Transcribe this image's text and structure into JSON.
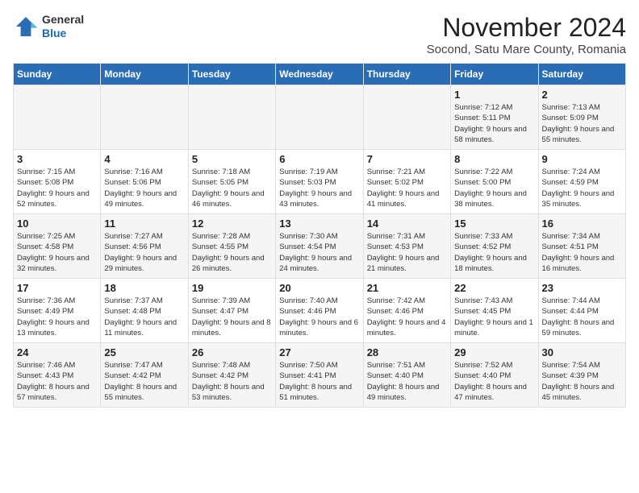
{
  "header": {
    "logo_line1": "General",
    "logo_line2": "Blue",
    "month_title": "November 2024",
    "subtitle": "Socond, Satu Mare County, Romania"
  },
  "days_of_week": [
    "Sunday",
    "Monday",
    "Tuesday",
    "Wednesday",
    "Thursday",
    "Friday",
    "Saturday"
  ],
  "weeks": [
    [
      {
        "day": "",
        "info": ""
      },
      {
        "day": "",
        "info": ""
      },
      {
        "day": "",
        "info": ""
      },
      {
        "day": "",
        "info": ""
      },
      {
        "day": "",
        "info": ""
      },
      {
        "day": "1",
        "info": "Sunrise: 7:12 AM\nSunset: 5:11 PM\nDaylight: 9 hours and 58 minutes."
      },
      {
        "day": "2",
        "info": "Sunrise: 7:13 AM\nSunset: 5:09 PM\nDaylight: 9 hours and 55 minutes."
      }
    ],
    [
      {
        "day": "3",
        "info": "Sunrise: 7:15 AM\nSunset: 5:08 PM\nDaylight: 9 hours and 52 minutes."
      },
      {
        "day": "4",
        "info": "Sunrise: 7:16 AM\nSunset: 5:06 PM\nDaylight: 9 hours and 49 minutes."
      },
      {
        "day": "5",
        "info": "Sunrise: 7:18 AM\nSunset: 5:05 PM\nDaylight: 9 hours and 46 minutes."
      },
      {
        "day": "6",
        "info": "Sunrise: 7:19 AM\nSunset: 5:03 PM\nDaylight: 9 hours and 43 minutes."
      },
      {
        "day": "7",
        "info": "Sunrise: 7:21 AM\nSunset: 5:02 PM\nDaylight: 9 hours and 41 minutes."
      },
      {
        "day": "8",
        "info": "Sunrise: 7:22 AM\nSunset: 5:00 PM\nDaylight: 9 hours and 38 minutes."
      },
      {
        "day": "9",
        "info": "Sunrise: 7:24 AM\nSunset: 4:59 PM\nDaylight: 9 hours and 35 minutes."
      }
    ],
    [
      {
        "day": "10",
        "info": "Sunrise: 7:25 AM\nSunset: 4:58 PM\nDaylight: 9 hours and 32 minutes."
      },
      {
        "day": "11",
        "info": "Sunrise: 7:27 AM\nSunset: 4:56 PM\nDaylight: 9 hours and 29 minutes."
      },
      {
        "day": "12",
        "info": "Sunrise: 7:28 AM\nSunset: 4:55 PM\nDaylight: 9 hours and 26 minutes."
      },
      {
        "day": "13",
        "info": "Sunrise: 7:30 AM\nSunset: 4:54 PM\nDaylight: 9 hours and 24 minutes."
      },
      {
        "day": "14",
        "info": "Sunrise: 7:31 AM\nSunset: 4:53 PM\nDaylight: 9 hours and 21 minutes."
      },
      {
        "day": "15",
        "info": "Sunrise: 7:33 AM\nSunset: 4:52 PM\nDaylight: 9 hours and 18 minutes."
      },
      {
        "day": "16",
        "info": "Sunrise: 7:34 AM\nSunset: 4:51 PM\nDaylight: 9 hours and 16 minutes."
      }
    ],
    [
      {
        "day": "17",
        "info": "Sunrise: 7:36 AM\nSunset: 4:49 PM\nDaylight: 9 hours and 13 minutes."
      },
      {
        "day": "18",
        "info": "Sunrise: 7:37 AM\nSunset: 4:48 PM\nDaylight: 9 hours and 11 minutes."
      },
      {
        "day": "19",
        "info": "Sunrise: 7:39 AM\nSunset: 4:47 PM\nDaylight: 9 hours and 8 minutes."
      },
      {
        "day": "20",
        "info": "Sunrise: 7:40 AM\nSunset: 4:46 PM\nDaylight: 9 hours and 6 minutes."
      },
      {
        "day": "21",
        "info": "Sunrise: 7:42 AM\nSunset: 4:46 PM\nDaylight: 9 hours and 4 minutes."
      },
      {
        "day": "22",
        "info": "Sunrise: 7:43 AM\nSunset: 4:45 PM\nDaylight: 9 hours and 1 minute."
      },
      {
        "day": "23",
        "info": "Sunrise: 7:44 AM\nSunset: 4:44 PM\nDaylight: 8 hours and 59 minutes."
      }
    ],
    [
      {
        "day": "24",
        "info": "Sunrise: 7:46 AM\nSunset: 4:43 PM\nDaylight: 8 hours and 57 minutes."
      },
      {
        "day": "25",
        "info": "Sunrise: 7:47 AM\nSunset: 4:42 PM\nDaylight: 8 hours and 55 minutes."
      },
      {
        "day": "26",
        "info": "Sunrise: 7:48 AM\nSunset: 4:42 PM\nDaylight: 8 hours and 53 minutes."
      },
      {
        "day": "27",
        "info": "Sunrise: 7:50 AM\nSunset: 4:41 PM\nDaylight: 8 hours and 51 minutes."
      },
      {
        "day": "28",
        "info": "Sunrise: 7:51 AM\nSunset: 4:40 PM\nDaylight: 8 hours and 49 minutes."
      },
      {
        "day": "29",
        "info": "Sunrise: 7:52 AM\nSunset: 4:40 PM\nDaylight: 8 hours and 47 minutes."
      },
      {
        "day": "30",
        "info": "Sunrise: 7:54 AM\nSunset: 4:39 PM\nDaylight: 8 hours and 45 minutes."
      }
    ]
  ]
}
